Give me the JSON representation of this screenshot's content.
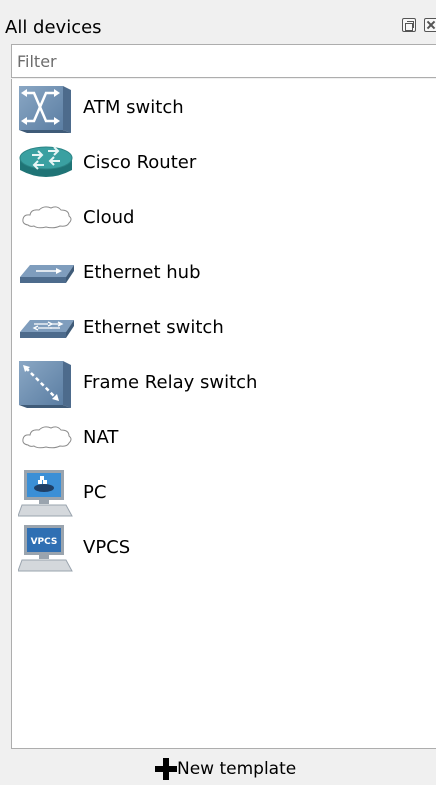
{
  "panel": {
    "title": "All devices",
    "filter_placeholder": "Filter",
    "filter_value": ""
  },
  "devices": [
    {
      "label": "ATM switch",
      "icon": "atm-switch-icon"
    },
    {
      "label": "Cisco Router",
      "icon": "router-icon"
    },
    {
      "label": "Cloud",
      "icon": "cloud-icon"
    },
    {
      "label": "Ethernet hub",
      "icon": "ethernet-hub-icon"
    },
    {
      "label": "Ethernet switch",
      "icon": "ethernet-switch-icon"
    },
    {
      "label": "Frame Relay switch",
      "icon": "frame-relay-switch-icon"
    },
    {
      "label": "NAT",
      "icon": "cloud-icon"
    },
    {
      "label": "PC",
      "icon": "pc-icon"
    },
    {
      "label": "VPCS",
      "icon": "vpcs-icon"
    }
  ],
  "icon_text": {
    "vpcs": "VPCS"
  },
  "footer": {
    "new_template_label": "New template"
  },
  "colors": {
    "device_blue": "#6d8fb0",
    "router_teal": "#2e8b8c",
    "background": "#f0f0f0",
    "list_background": "#ffffff"
  }
}
